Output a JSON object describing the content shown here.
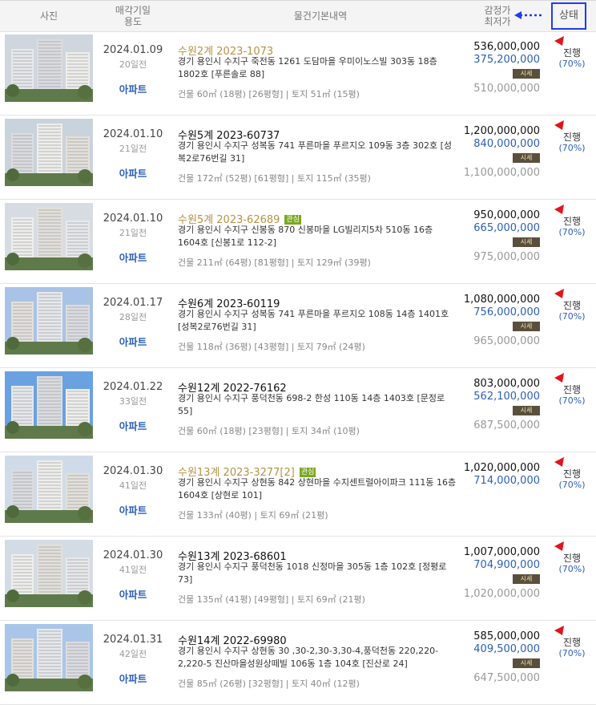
{
  "header": {
    "photo": "사진",
    "date_line1": "매각기일",
    "date_line2": "용도",
    "info": "물건기본내역",
    "price_line1": "감정가",
    "price_line2": "최저가",
    "status": "상태"
  },
  "rows": [
    {
      "date": "2024.01.09",
      "days": "20일전",
      "use": "아파트",
      "case": "수원2계 2023-1073",
      "case_color": "gold",
      "interest": false,
      "addr": "경기 용인시 수지구 죽전동 1261 도담마을 우미이노스빌 303동 18층 1802호 [푸른솔로 88]",
      "area": "건물 60㎡ (18평) [26평형]  |  토지 51㎡ (15평)",
      "appraisal": "536,000,000",
      "min_price": "375,200,000",
      "market_label": "시세",
      "sale": "510,000,000",
      "status": "진행",
      "rate": "(70%)"
    },
    {
      "date": "2024.01.10",
      "days": "21일전",
      "use": "아파트",
      "case": "수원5계 2023-60737",
      "case_color": "black",
      "interest": false,
      "addr": "경기 용인시 수지구 성복동 741 푸른마을 푸르지오 109동 3층 302호 [성복2로76번길 31]",
      "area": "건물 172㎡ (52평) [61평형]  |  토지 115㎡ (35평)",
      "appraisal": "1,200,000,000",
      "min_price": "840,000,000",
      "market_label": "시세",
      "sale": "1,100,000,000",
      "status": "진행",
      "rate": "(70%)"
    },
    {
      "date": "2024.01.10",
      "days": "21일전",
      "use": "아파트",
      "case": "수원5계 2023-62689",
      "case_color": "gold",
      "interest": true,
      "interest_label": "관심",
      "addr": "경기 용인시 수지구 신봉동 870 신봉마을 LG빌리지5차 510동 16층 1604호 [신봉1로 112-2]",
      "area": "건물 211㎡ (64평) [81평형]  |  토지 129㎡ (39평)",
      "appraisal": "950,000,000",
      "min_price": "665,000,000",
      "market_label": "시세",
      "sale": "975,000,000",
      "status": "진행",
      "rate": "(70%)"
    },
    {
      "date": "2024.01.17",
      "days": "28일전",
      "use": "아파트",
      "case": "수원6계 2023-60119",
      "case_color": "black",
      "interest": false,
      "addr": "경기 용인시 수지구 성복동 741 푸른마을 푸르지오 108동 14층 1401호 [성복2로76번길 31]",
      "area": "건물 118㎡ (36평) [43평형]  |  토지 79㎡ (24평)",
      "appraisal": "1,080,000,000",
      "min_price": "756,000,000",
      "market_label": "시세",
      "sale": "965,000,000",
      "status": "진행",
      "rate": "(70%)"
    },
    {
      "date": "2024.01.22",
      "days": "33일전",
      "use": "아파트",
      "case": "수원12계 2022-76162",
      "case_color": "black",
      "interest": false,
      "addr": "경기 용인시 수지구 풍덕천동 698-2 한성 110동 14층 1403호 [문정로 55]",
      "area": "건물 60㎡ (18평) [23평형]  |  토지 34㎡ (10평)",
      "appraisal": "803,000,000",
      "min_price": "562,100,000",
      "market_label": "시세",
      "sale": "687,500,000",
      "status": "진행",
      "rate": "(70%)"
    },
    {
      "date": "2024.01.30",
      "days": "41일전",
      "use": "아파트",
      "case": "수원13계 2023-3277[2]",
      "case_color": "gold",
      "interest": true,
      "interest_label": "관심",
      "addr": "경기 용인시 수지구 상현동 842 상현마을 수지센트럴아이파크 111동 16층 1604호 [상현로 101]",
      "area": "건물 133㎡ (40평)  |  토지 69㎡ (21평)",
      "appraisal": "1,020,000,000",
      "min_price": "714,000,000",
      "market_label": "",
      "sale": "",
      "status": "진행",
      "rate": "(70%)"
    },
    {
      "date": "2024.01.30",
      "days": "41일전",
      "use": "아파트",
      "case": "수원13계 2023-68601",
      "case_color": "black",
      "interest": false,
      "addr": "경기 용인시 수지구 풍덕천동 1018 신정마을 305동 1층 102호 [정평로 73]",
      "area": "건물 135㎡ (41평) [49평형]  |  토지 69㎡ (21평)",
      "appraisal": "1,007,000,000",
      "min_price": "704,900,000",
      "market_label": "시세",
      "sale": "1,020,000,000",
      "status": "진행",
      "rate": "(70%)"
    },
    {
      "date": "2024.01.31",
      "days": "42일전",
      "use": "아파트",
      "case": "수원14계 2022-69980",
      "case_color": "black",
      "interest": false,
      "addr": "경기 용인시 수지구 상현동 30 ,30-2,30-3,30-4,풍덕천동 220,220-2,220-5 진산마을성원상떼빌 106동 1층 104호 [진산로 24]",
      "area": "건물 85㎡ (26평) [32평형]  |  토지 40㎡ (12평)",
      "appraisal": "585,000,000",
      "min_price": "409,500,000",
      "market_label": "시세",
      "sale": "647,500,000",
      "status": "진행",
      "rate": "(70%)"
    }
  ],
  "colors": {
    "gold_case": "#b69244",
    "blue_price": "#2b5fb8",
    "annotation_red": "#e0141e",
    "annotation_blue": "#1f3cf0",
    "interest_badge": "#7aa822"
  }
}
